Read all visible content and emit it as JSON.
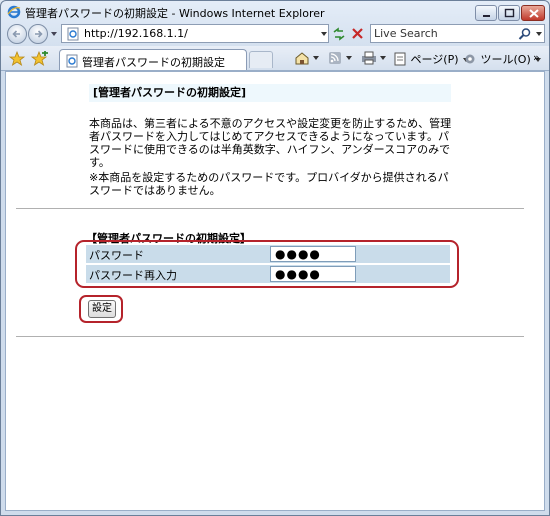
{
  "window": {
    "title": "管理者パスワードの初期設定 - Windows Internet Explorer"
  },
  "toolbar": {
    "url": "http://192.168.1.1/",
    "search_placeholder": "Live Search"
  },
  "tabs": [
    {
      "label": "管理者パスワードの初期設定"
    }
  ],
  "commands": {
    "page_label": "ページ(P)",
    "tools_label": "ツール(O)",
    "more_label": "»"
  },
  "page": {
    "section_title": "[管理者パスワードの初期設定]",
    "description": "本商品は、第三者による不意のアクセスや設定変更を防止するため、管理者パスワードを入力してはじめてアクセスできるようになっています。パスワードに使用できるのは半角英数字、ハイフン、アンダースコアのみです。",
    "note": "※本商品を設定するためのパスワードです。プロバイダから提供されるパスワードではありません。",
    "form_title": "【管理者パスワードの初期設定】",
    "fields": [
      {
        "label": "パスワード",
        "value": "●●●●"
      },
      {
        "label": "パスワード再入力",
        "value": "●●●●"
      }
    ],
    "submit_label": "設定"
  },
  "colors": {
    "highlight": "#b5232b",
    "field_row": "#c9dcea",
    "title_bg": "#eef8fd"
  }
}
